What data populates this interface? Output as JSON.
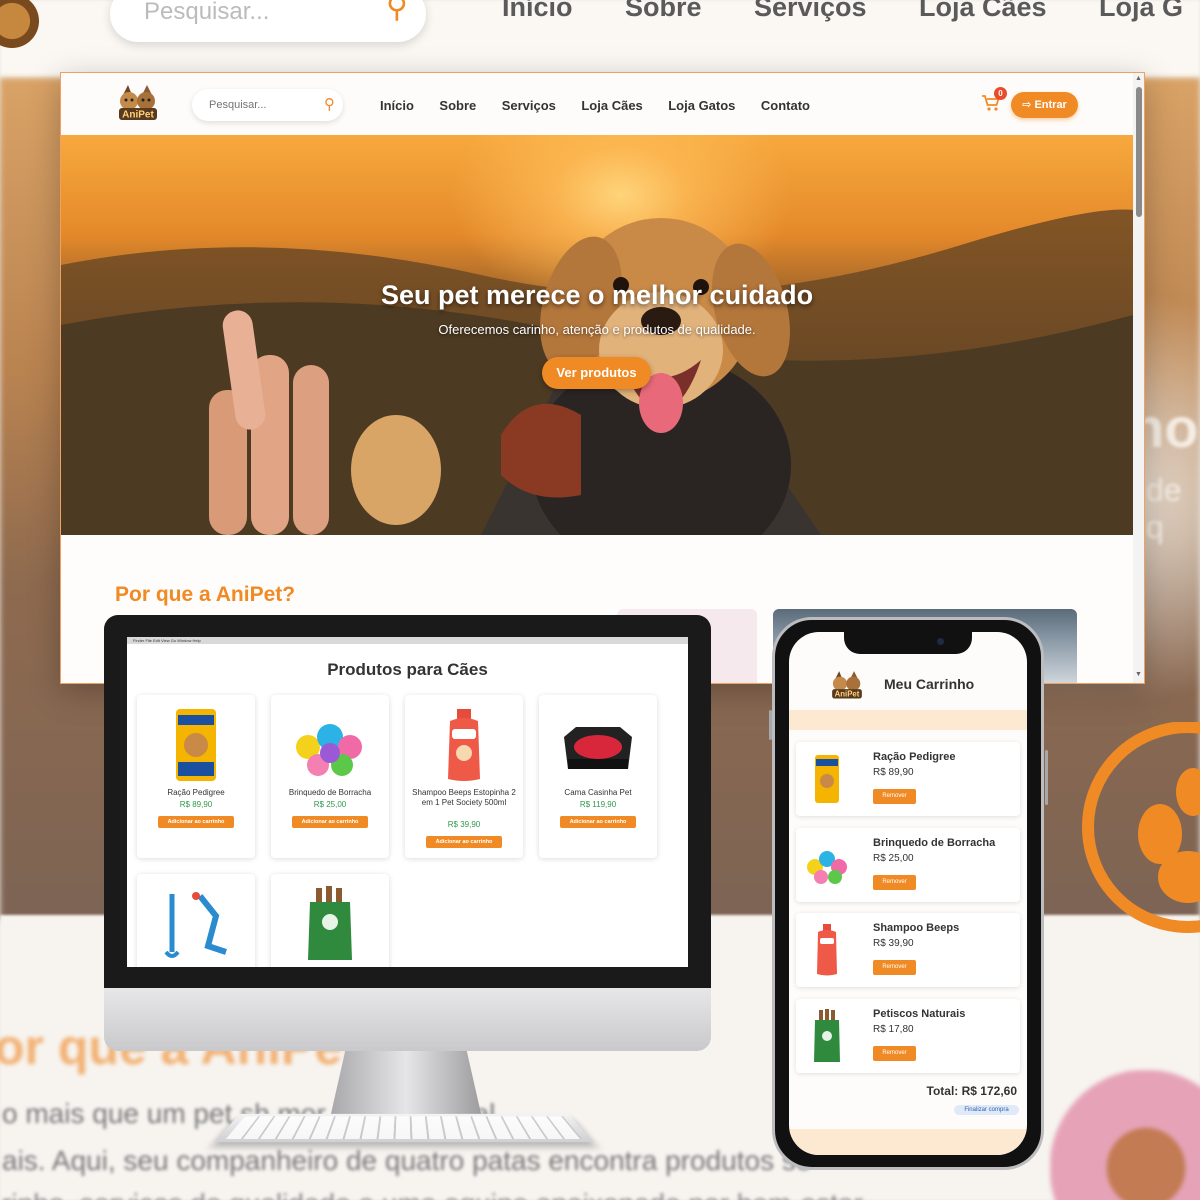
{
  "backdrop": {
    "search_placeholder": "Pesquisar...",
    "nav": [
      "Início",
      "Sobre",
      "Serviços",
      "Loja Cães",
      "Loja G"
    ],
    "hero_fragment_1": "no",
    "hero_fragment_2": "de q",
    "why_fragment": "or que a AniPet",
    "para_line_1": "o mais que um pet sh                               mor incondicional",
    "para_line_2": "ais. Aqui, seu companheiro de quatro patas encontra produtos se",
    "para_line_3": "rinho, serviços de qualidade e uma equipe apaixonada por bem-estar"
  },
  "site": {
    "logo_text": "AniPet",
    "search": {
      "placeholder": "Pesquisar...",
      "icon": "search-icon"
    },
    "nav": [
      {
        "label": "Início"
      },
      {
        "label": "Sobre"
      },
      {
        "label": "Serviços"
      },
      {
        "label": "Loja Cães"
      },
      {
        "label": "Loja Gatos"
      },
      {
        "label": "Contato"
      }
    ],
    "cart": {
      "icon": "cart-icon",
      "count": "0"
    },
    "login": {
      "icon": "sign-in-icon",
      "label": "Entrar"
    },
    "hero": {
      "title": "Seu pet merece o melhor cuidado",
      "subtitle": "Oferecemos carinho, atenção e produtos de qualidade.",
      "cta": "Ver produtos"
    },
    "why_title": "Por que a AniPet?"
  },
  "desktop_shop": {
    "menubar": "  Finder    File    Edit    View    Go    Window    Help",
    "title": "Produtos para Cães",
    "add_label": "Adicionar ao carrinho",
    "products": [
      {
        "name": "Ração Pedigree",
        "price": "R$ 89,90"
      },
      {
        "name": "Brinquedo de Borracha",
        "price": "R$ 25,00"
      },
      {
        "name": "Shampoo Beeps Estopinha 2 em 1 Pet Society 500ml",
        "price": "R$ 39,90"
      },
      {
        "name": "Cama Casinha Pet",
        "price": "R$ 119,90"
      }
    ]
  },
  "mobile_cart": {
    "title": "Meu Carrinho",
    "remove_label": "Remover",
    "items": [
      {
        "name": "Ração Pedigree",
        "price": "R$ 89,90"
      },
      {
        "name": "Brinquedo de Borracha",
        "price": "R$ 25,00"
      },
      {
        "name": "Shampoo Beeps",
        "price": "R$ 39,90"
      },
      {
        "name": "Petiscos Naturais",
        "price": "R$ 17,80"
      }
    ],
    "total": "Total: R$ 172,60",
    "checkout": "Finalizar compra"
  },
  "colors": {
    "accent": "#f08a24",
    "price_green": "#2e9a4a",
    "badge_red": "#e84c2b"
  }
}
